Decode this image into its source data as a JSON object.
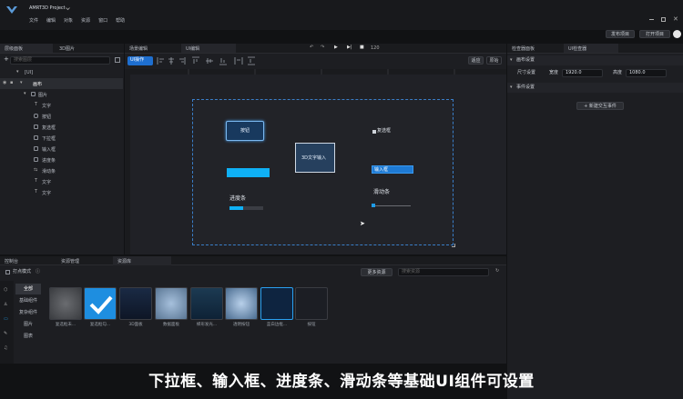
{
  "titlebar": {
    "project": "AMRT3D Project",
    "menus": [
      "文件",
      "编辑",
      "对象",
      "资源",
      "窗口",
      "帮助"
    ],
    "publish_label": "发布项目",
    "open_label": "打开项目"
  },
  "left_panel": {
    "tabs": [
      "层级面板",
      "3D图片"
    ],
    "search_placeholder": "搜索图层",
    "items": [
      {
        "label": "[UI]",
        "indent": 0
      },
      {
        "label": "画布",
        "indent": 1
      },
      {
        "label": "图片",
        "indent": 2
      },
      {
        "label": "文字",
        "indent": 3
      },
      {
        "label": "按钮",
        "indent": 3
      },
      {
        "label": "复选框",
        "indent": 3
      },
      {
        "label": "下拉框",
        "indent": 3
      },
      {
        "label": "输入框",
        "indent": 3
      },
      {
        "label": "进度条",
        "indent": 3
      },
      {
        "label": "滑动条",
        "indent": 3
      },
      {
        "label": "文字",
        "indent": 3
      },
      {
        "label": "文字",
        "indent": 3
      }
    ]
  },
  "center_panel": {
    "tabs": [
      "场景编辑",
      "UI编辑"
    ],
    "frame_count": "120",
    "tool_mode": "UI操作",
    "view_toggle_a": "适应",
    "view_toggle_b": "原始",
    "canvas": {
      "button_label": "按钮",
      "text_input_label": "3D文字输入",
      "checkbox_label": "复选框",
      "input_label": "输入框",
      "progress_label": "进度条",
      "slider_label": "滑动条"
    }
  },
  "right_panel": {
    "tabs": [
      "检查器面板",
      "UI检查器"
    ],
    "section_canvas": "画布设置",
    "size_label": "尺寸设置",
    "width_label": "宽度",
    "width_value": "1920.0",
    "height_label": "高度",
    "height_value": "1080.0",
    "section_event": "事件设置",
    "add_event_label": "+ 新建交互事件"
  },
  "bottom_panel": {
    "tabs": [
      "控制台",
      "资源管理",
      "资源库"
    ],
    "mode_label": "打点模式",
    "more_label": "更多资源",
    "search_placeholder": "搜索资源",
    "categories": [
      "全部",
      "基础组件",
      "复杂组件",
      "图片",
      "图表"
    ],
    "assets": [
      "复选框未...",
      "复选框勾...",
      "3D面板",
      "数据面板",
      "梯形发光...",
      "透明按钮",
      "蓝白边框...",
      "按钮"
    ]
  },
  "subtitle": "下拉框、输入框、进度条、滑动条等基础UI组件可设置",
  "colors": {
    "accent": "#1e9ce8",
    "canvas_border": "#3a7ec8",
    "bar": "#0fb0f5"
  }
}
